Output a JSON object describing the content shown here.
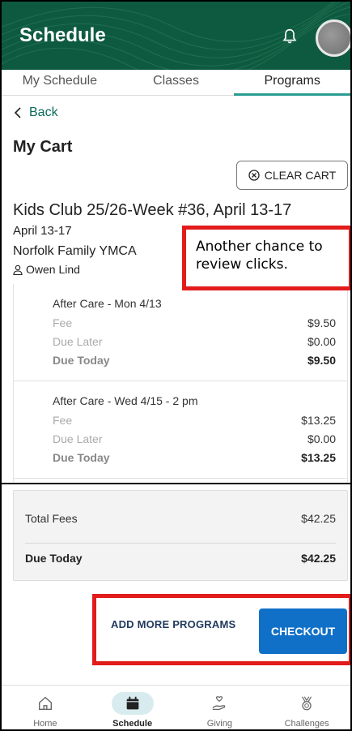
{
  "header": {
    "title": "Schedule"
  },
  "tabs": [
    "My Schedule",
    "Classes",
    "Programs"
  ],
  "back_label": "Back",
  "page_title": "My Cart",
  "clear_cart_label": "CLEAR CART",
  "program": {
    "title": "Kids Club 25/26-Week #36, April 13-17",
    "dates": "April 13-17",
    "location": "Norfolk Family YMCA",
    "participant": "Owen Lind"
  },
  "callout_text": "Another chance to review clicks.",
  "items": [
    {
      "name": "After Care - Mon 4/13",
      "fee_label": "Fee",
      "fee": "$9.50",
      "due_later_label": "Due Later",
      "due_later": "$0.00",
      "due_today_label": "Due Today",
      "due_today": "$9.50"
    },
    {
      "name": "After Care - Wed 4/15 - 2 pm",
      "fee_label": "Fee",
      "fee": "$13.25",
      "due_later_label": "Due Later",
      "due_later": "$0.00",
      "due_today_label": "Due Today",
      "due_today": "$13.25"
    }
  ],
  "summary": {
    "total_fees_label": "Total Fees",
    "total_fees": "$42.25",
    "due_today_label": "Due Today",
    "due_today": "$42.25"
  },
  "actions": {
    "add_more": "ADD MORE PROGRAMS",
    "checkout": "CHECKOUT"
  },
  "bottom_nav": [
    {
      "label": "Home",
      "icon": "home-icon"
    },
    {
      "label": "Schedule",
      "icon": "calendar-icon"
    },
    {
      "label": "Giving",
      "icon": "giving-hand-icon"
    },
    {
      "label": "Challenges",
      "icon": "medal-icon"
    }
  ],
  "colors": {
    "header": "#0e5a40",
    "accent": "#2a9c92",
    "primary_button": "#1070c8",
    "highlight": "#e21b1b"
  }
}
